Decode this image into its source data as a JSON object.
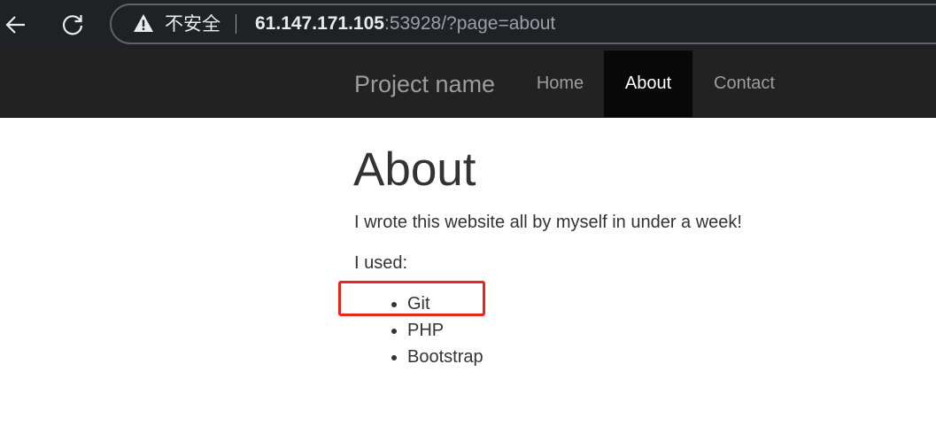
{
  "browser": {
    "security_label": "不安全",
    "url_host": "61.147.171.105",
    "url_rest": ":53928/?page=about"
  },
  "navbar": {
    "brand": "Project name",
    "links": [
      {
        "label": "Home",
        "active": false
      },
      {
        "label": "About",
        "active": true
      },
      {
        "label": "Contact",
        "active": false
      }
    ]
  },
  "content": {
    "title": "About",
    "intro": "I wrote this website all by myself in under a week!",
    "used_label": "I used:",
    "technologies": [
      "Git",
      "PHP",
      "Bootstrap"
    ]
  },
  "annotation": {
    "highlight_color": "#e8261c",
    "highlighted_item": "Git"
  },
  "colors": {
    "navbar_bg": "#222222",
    "navbar_active_bg": "#080808",
    "text": "#333333"
  }
}
